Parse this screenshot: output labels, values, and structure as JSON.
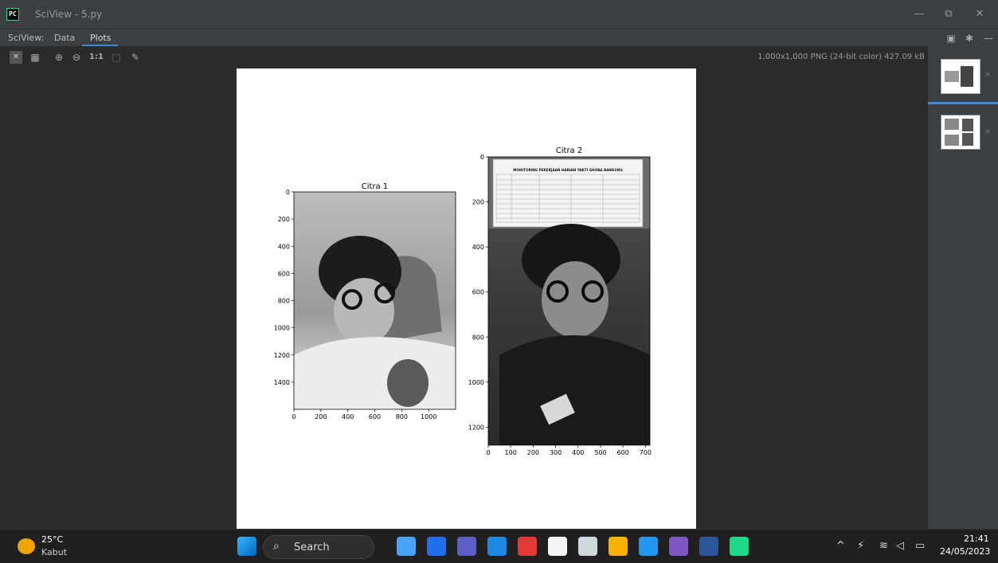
{
  "window": {
    "logo_text": "PC",
    "title": "SciView - 5.py",
    "minimize": "—",
    "maximize": "⧉",
    "close": "✕"
  },
  "tabs": {
    "prefix": "SciView:",
    "items": [
      {
        "label": "Data"
      },
      {
        "label": "Plots"
      }
    ],
    "icons": [
      "layout-icon",
      "gear-icon",
      "hide-icon"
    ]
  },
  "toolbar": {
    "icons": [
      "fit-to-window-icon",
      "grid-icon",
      "zoom-in-icon",
      "zoom-out-icon",
      "actual-size-icon",
      "background-icon",
      "color-picker-icon"
    ],
    "actual_size_label": "1:1",
    "image_info": "1,000x1,000 PNG (24-bit color) 427.09 kB"
  },
  "figure": {
    "subplots": [
      {
        "title": "Citra 1",
        "x_ticks": [
          "0",
          "200",
          "400",
          "600",
          "800",
          "1000"
        ],
        "y_ticks": [
          "0",
          "200",
          "400",
          "600",
          "800",
          "1000",
          "1200",
          "1400"
        ]
      },
      {
        "title": "Citra 2",
        "x_ticks": [
          "0",
          "100",
          "200",
          "300",
          "400",
          "500",
          "600",
          "700"
        ],
        "y_ticks": [
          "0",
          "200",
          "400",
          "600",
          "800",
          "1000",
          "1200"
        ],
        "doc_heading": "MONITORING PEKERJAAN HARIAN YAKTI GHOBA BANDUNG"
      }
    ]
  },
  "thumbnails": {
    "close_glyph": "×",
    "items": [
      {
        "name": "thumbnail-1"
      },
      {
        "name": "thumbnail-2"
      }
    ]
  },
  "taskbar": {
    "weather_temp": "25°C",
    "weather_desc": "Kabut",
    "search_label": "Search",
    "time": "21:41",
    "date": "24/05/2023",
    "tray_chevron": "^",
    "app_colors": [
      "#4aa3ff",
      "#1f6feb",
      "#5b5fc7",
      "#1e88e5",
      "#e53935",
      "#f5f5f5",
      "#cfd8dc",
      "#f6b100",
      "#2196f3",
      "#7e57c2",
      "#2b579a",
      "#21d789"
    ]
  }
}
